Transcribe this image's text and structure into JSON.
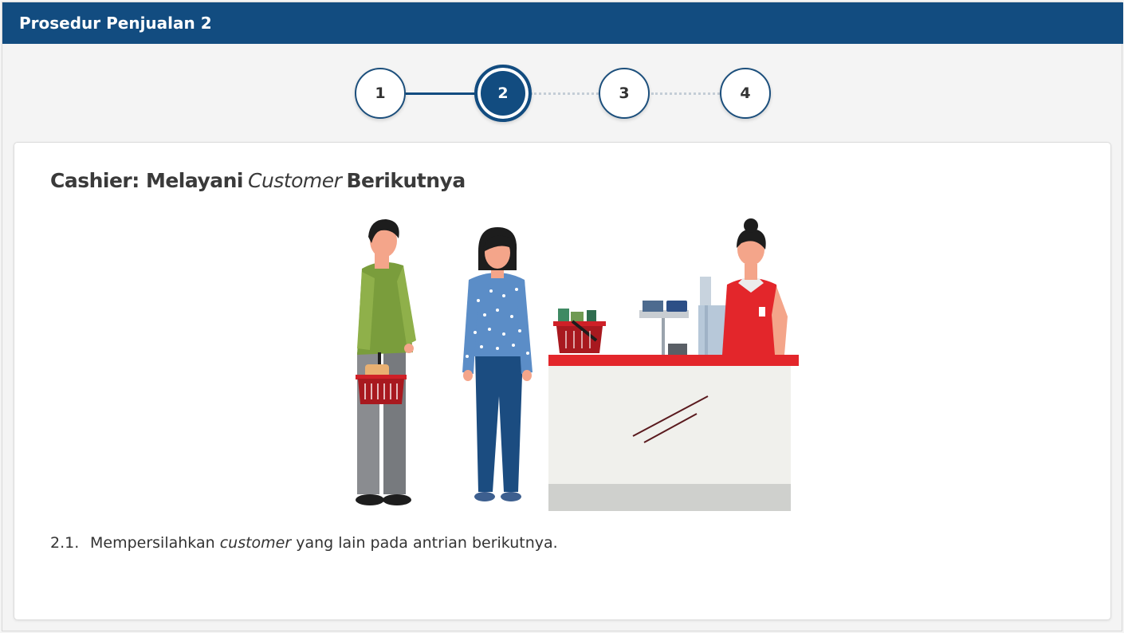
{
  "header": {
    "title": "Prosedur Penjualan 2"
  },
  "stepper": {
    "steps": [
      {
        "label": "1",
        "state": "done"
      },
      {
        "label": "2",
        "state": "active"
      },
      {
        "label": "3",
        "state": "upcoming"
      },
      {
        "label": "4",
        "state": "upcoming"
      }
    ]
  },
  "content": {
    "title_part1": "Cashier: Melayani",
    "title_em": "Customer",
    "title_part2": "Berikutnya",
    "item_number": "2.1.",
    "item_part1": "Mempersilahkan",
    "item_em": "customer",
    "item_part2": "yang lain pada antrian berikutnya."
  },
  "colors": {
    "header_bg": "#124c80",
    "accent": "#124c80",
    "counter_red": "#e3262b"
  }
}
